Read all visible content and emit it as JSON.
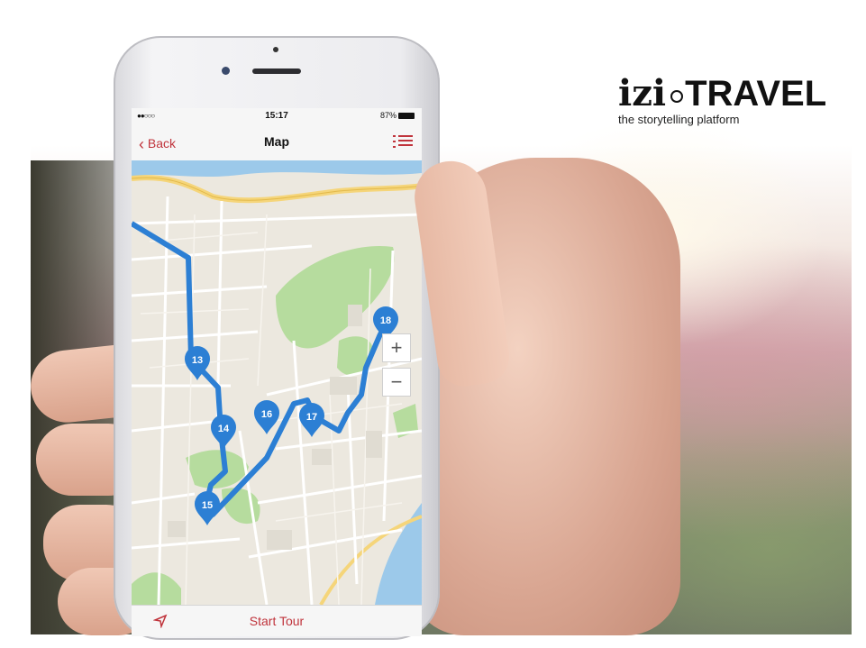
{
  "logo": {
    "brand_left": "izi",
    "brand_right": "TRAVEL",
    "tagline": "the storytelling platform"
  },
  "app": {
    "status_bar": {
      "time": "15:17",
      "battery": "87%"
    },
    "nav": {
      "back_label": "Back",
      "title": "Map"
    },
    "map": {
      "markers": [
        "13",
        "14",
        "15",
        "16",
        "17",
        "18"
      ],
      "zoom_in_label": "+",
      "zoom_out_label": "−"
    },
    "bottom": {
      "start_label": "Start Tour"
    }
  },
  "colors": {
    "accent": "#c0343c",
    "route": "#2c7fd4",
    "marker": "#2c7fd4",
    "park": "#b6dc9e",
    "water": "#9cc9ea"
  },
  "icons": [
    "back-chevron-icon",
    "list-icon",
    "location-arrow-icon",
    "map-pin-icon"
  ]
}
